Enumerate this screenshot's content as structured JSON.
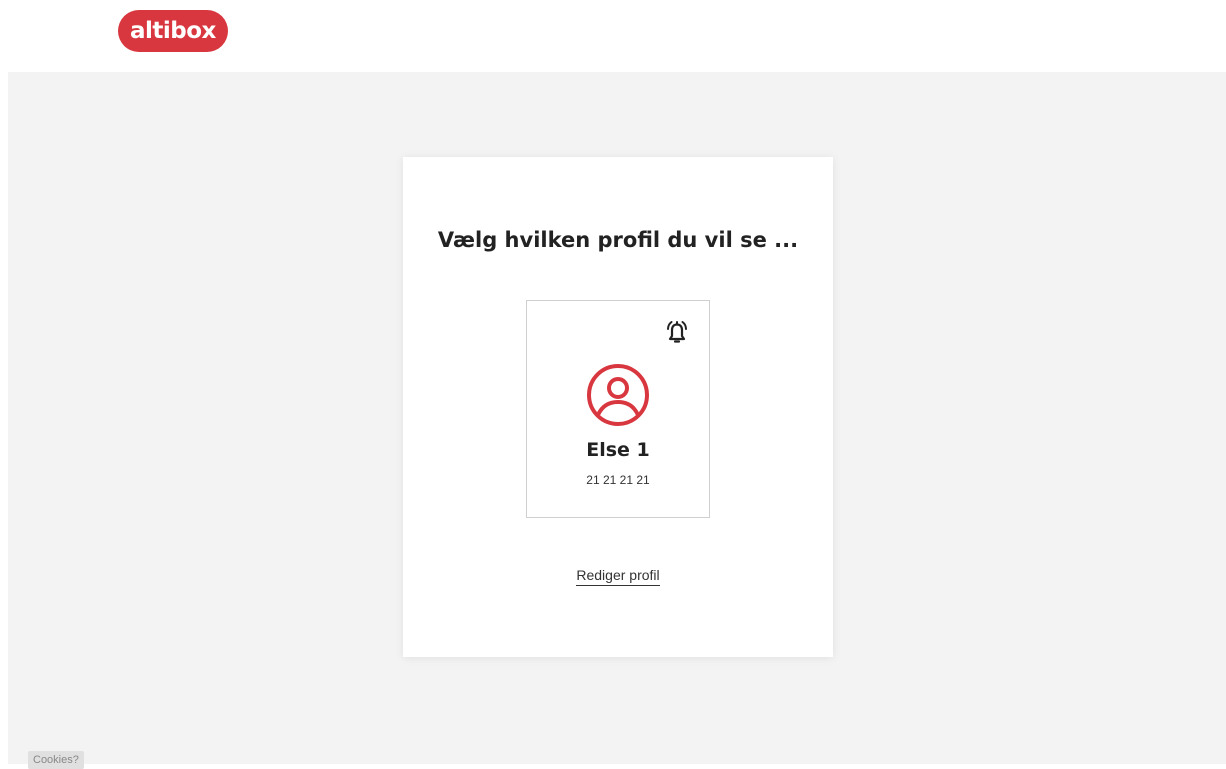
{
  "header": {
    "logo_text": "altibox",
    "brand_color": "#d9373f"
  },
  "card": {
    "title": "Vælg hvilken profil du vil se ...",
    "profiles": [
      {
        "name": "Else 1",
        "phone": "21 21 21 21",
        "icon": "user-circle-icon",
        "badge_icon": "bell-icon"
      }
    ],
    "edit_link": "Rediger profil"
  },
  "footer": {
    "cookies_label": "Cookies?"
  }
}
